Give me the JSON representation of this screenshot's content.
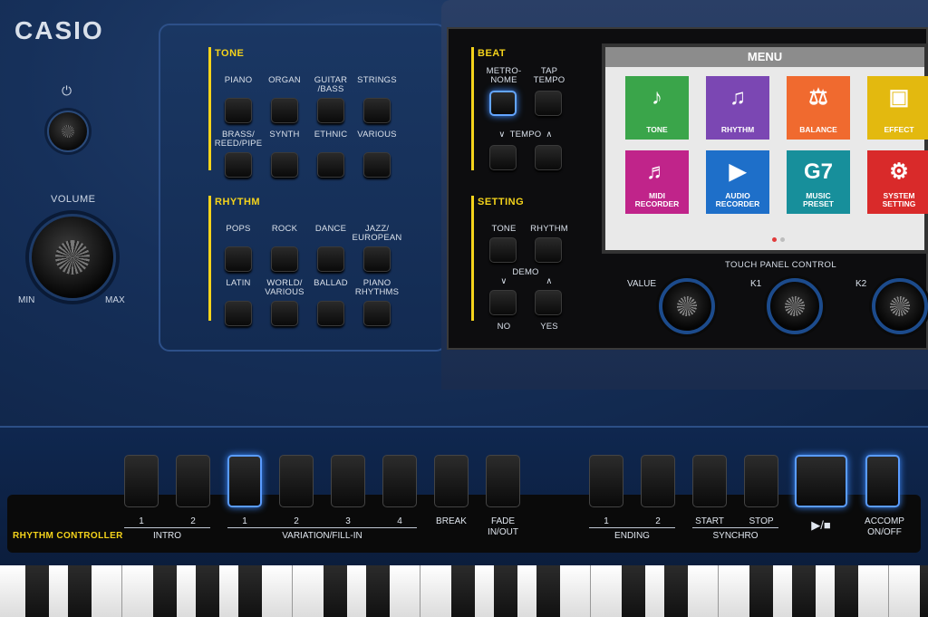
{
  "brand": "CASIO",
  "power": {
    "symbol": "⏻"
  },
  "volume": {
    "label": "VOLUME",
    "min": "MIN",
    "max": "MAX"
  },
  "tone": {
    "title": "TONE",
    "buttons": [
      "PIANO",
      "ORGAN",
      "GUITAR\n/BASS",
      "STRINGS",
      "BRASS/\nREED/PIPE",
      "SYNTH",
      "ETHNIC",
      "VARIOUS"
    ]
  },
  "rhythm": {
    "title": "RHYTHM",
    "buttons": [
      "POPS",
      "ROCK",
      "DANCE",
      "JAZZ/\nEUROPEAN",
      "LATIN",
      "WORLD/\nVARIOUS",
      "BALLAD",
      "PIANO\nRHYTHMS"
    ]
  },
  "beat": {
    "title": "BEAT",
    "metronome": "METRO-\nNOME",
    "tap_tempo": "TAP\nTEMPO",
    "tempo": "TEMPO",
    "tempo_down": "∨",
    "tempo_up": "∧"
  },
  "setting": {
    "title": "SETTING",
    "tone": "TONE",
    "rhythm": "RHYTHM",
    "demo": "DEMO",
    "no_arrow": "∨",
    "yes_arrow": "∧",
    "no": "NO",
    "yes": "YES"
  },
  "screen": {
    "title": "MENU",
    "tiles": [
      {
        "label": "TONE",
        "icon": "keyboard-icon",
        "glyph": "♪",
        "color": "#3aa54a"
      },
      {
        "label": "RHYTHM",
        "icon": "drum-icon",
        "glyph": "♫",
        "color": "#7b47b3"
      },
      {
        "label": "BALANCE",
        "icon": "balance-icon",
        "glyph": "⚖",
        "color": "#f06a2f"
      },
      {
        "label": "EFFECT",
        "icon": "effect-icon",
        "glyph": "▣",
        "color": "#e3b90f"
      },
      {
        "label": "MIDI\nRECORDER",
        "icon": "midi-recorder-icon",
        "glyph": "♬",
        "color": "#c0248a"
      },
      {
        "label": "AUDIO\nRECORDER",
        "icon": "audio-recorder-icon",
        "glyph": "▶",
        "color": "#1e6fc9"
      },
      {
        "label": "MUSIC\nPRESET",
        "icon": "music-preset-icon",
        "glyph": "G7",
        "color": "#178f9b"
      },
      {
        "label": "SYSTEM\nSETTING",
        "icon": "gear-icon",
        "glyph": "⚙",
        "color": "#d92a2a"
      }
    ],
    "page_dots": {
      "active": "#e13a3a",
      "inactive": "#bdbdbd"
    }
  },
  "touch_panel": {
    "label": "TOUCH PANEL CONTROL",
    "value": "VALUE",
    "k1": "K1",
    "k2": "K2"
  },
  "rhythm_controller": {
    "title": "RHYTHM CONTROLLER",
    "intro": {
      "label": "INTRO",
      "nums": [
        "1",
        "2"
      ]
    },
    "variation": {
      "label": "VARIATION/FILL-IN",
      "nums": [
        "1",
        "2",
        "3",
        "4"
      ]
    },
    "break": "BREAK",
    "fade": "FADE\nIN/OUT",
    "ending": {
      "label": "ENDING",
      "nums": [
        "1",
        "2"
      ]
    },
    "synchro": {
      "label": "SYNCHRO",
      "start": "START",
      "stop": "STOP"
    },
    "play_stop": "▶/■",
    "accomp": "ACCOMP\nON/OFF"
  },
  "colors": {
    "accent_yellow": "#f4d31b",
    "led_blue": "#5a9cff"
  }
}
